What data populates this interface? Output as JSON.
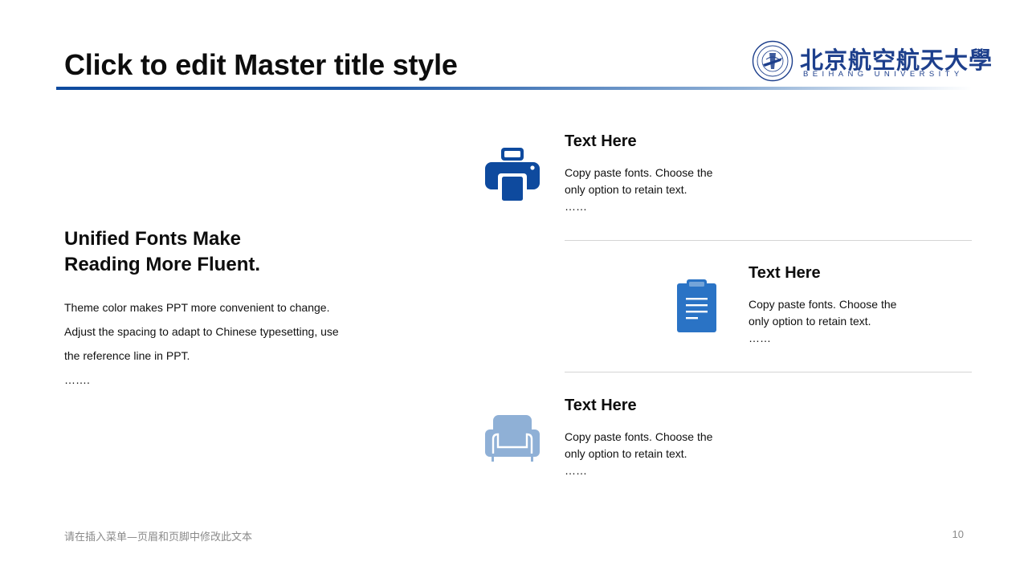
{
  "slide": {
    "title": "Click to edit Master title style",
    "page_number": "10",
    "footer_text": "请在插入菜单—页眉和页脚中修改此文本"
  },
  "logo": {
    "name_cn": "北京航空航天大學",
    "name_en": "BEIHANG UNIVERSITY"
  },
  "left": {
    "heading_line1": "Unified Fonts Make",
    "heading_line2": "Reading More Fluent.",
    "body_lines": [
      "Theme color makes  PPT more convenient  to change.",
      "Adjust  the spacing to adapt to Chinese typesetting,  use",
      "the reference line  in  PPT.",
      "……."
    ]
  },
  "cards": [
    {
      "icon": "printer-icon",
      "title": "Text Here",
      "body_line1": "Copy paste fonts. Choose the",
      "body_line2": "only  option to retain text.",
      "ellipsis": "……"
    },
    {
      "icon": "clipboard-icon",
      "title": "Text Here",
      "body_line1": "Copy paste fonts. Choose the",
      "body_line2": "only  option to retain text.",
      "ellipsis": "……"
    },
    {
      "icon": "sofa-icon",
      "title": "Text Here",
      "body_line1": "Copy paste fonts. Choose the",
      "body_line2": "only  option to retain text.",
      "ellipsis": "……"
    }
  ],
  "colors": {
    "accent_dark": "#0e4a9e",
    "accent_mid": "#2a73c5",
    "accent_light": "#8fb0d6",
    "logo_blue": "#1d3f8c"
  }
}
